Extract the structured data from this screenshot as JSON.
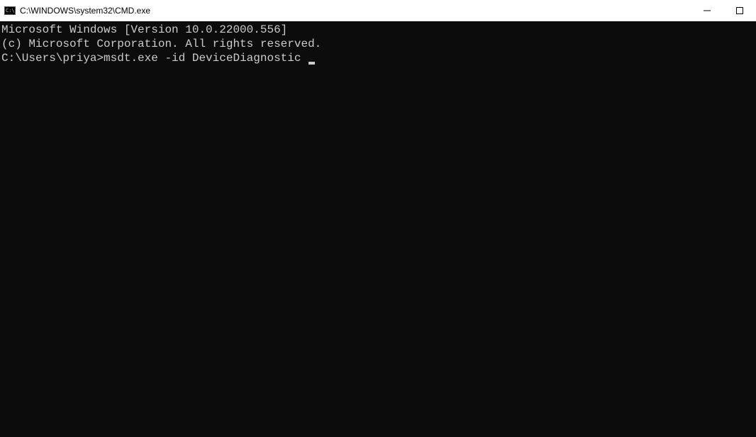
{
  "titlebar": {
    "title": "C:\\WINDOWS\\system32\\CMD.exe"
  },
  "terminal": {
    "line1": "Microsoft Windows [Version 10.0.22000.556]",
    "line2": "(c) Microsoft Corporation. All rights reserved.",
    "blank1": "",
    "prompt": "C:\\Users\\priya>",
    "command": "msdt.exe -id DeviceDiagnostic "
  }
}
